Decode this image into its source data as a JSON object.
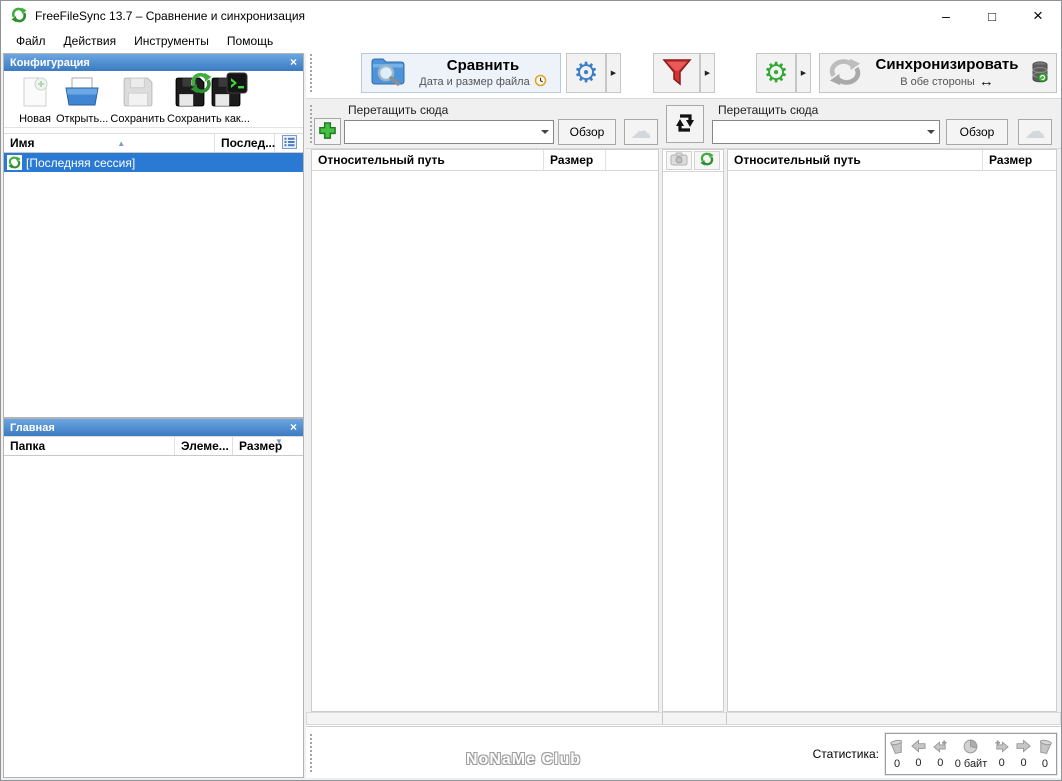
{
  "window": {
    "title": "FreeFileSync 13.7 – Сравнение и синхронизация",
    "minimize": "–",
    "maximize": "□",
    "close": "×"
  },
  "menu": {
    "items": [
      {
        "label": "Файл"
      },
      {
        "label": "Действия"
      },
      {
        "label": "Инструменты"
      },
      {
        "label": "Помощь"
      }
    ]
  },
  "icons": {
    "gear": "⚙",
    "cloud": "☁",
    "dropdown_arrow": "▶",
    "sort_asc": "▲",
    "sort_desc": "▼",
    "both_ways_arrow": "↔",
    "close": "×"
  },
  "config_panel": {
    "title": "Конфигурация",
    "buttons": {
      "new": "Новая",
      "open": "Открыть...",
      "save": "Сохранить",
      "save_as": "Сохранить как..."
    },
    "columns": {
      "name": "Имя",
      "last_sync": "Послед..."
    },
    "rows": [
      {
        "name": "[Последняя сессия]"
      }
    ]
  },
  "overview_panel": {
    "title": "Главная",
    "columns": {
      "folder": "Папка",
      "items": "Элеме...",
      "size": "Размер"
    }
  },
  "actions": {
    "compare": {
      "label": "Сравнить",
      "variant": "Дата и размер файла"
    },
    "synchronize": {
      "label": "Синхронизировать",
      "variant": "В обе стороны"
    }
  },
  "folder_pairs": {
    "left": {
      "hint": "Перетащить сюда",
      "path": "",
      "browse": "Обзор"
    },
    "right": {
      "hint": "Перетащить сюда",
      "path": "",
      "browse": "Обзор"
    }
  },
  "file_grids": {
    "left": {
      "path_column": "Относительный путь",
      "size_column": "Размер"
    },
    "right": {
      "path_column": "Относительный путь",
      "size_column": "Размер"
    }
  },
  "statusbar": {
    "watermark": "NoNaMe Club",
    "stats_label": "Статистика:",
    "stats": [
      {
        "name": "delete-left",
        "value": "0"
      },
      {
        "name": "update-left",
        "value": "0"
      },
      {
        "name": "create-left",
        "value": "0"
      },
      {
        "name": "bytes",
        "value": "0 байт"
      },
      {
        "name": "create-right",
        "value": "0"
      },
      {
        "name": "update-right",
        "value": "0"
      },
      {
        "name": "delete-right",
        "value": "0"
      }
    ]
  }
}
